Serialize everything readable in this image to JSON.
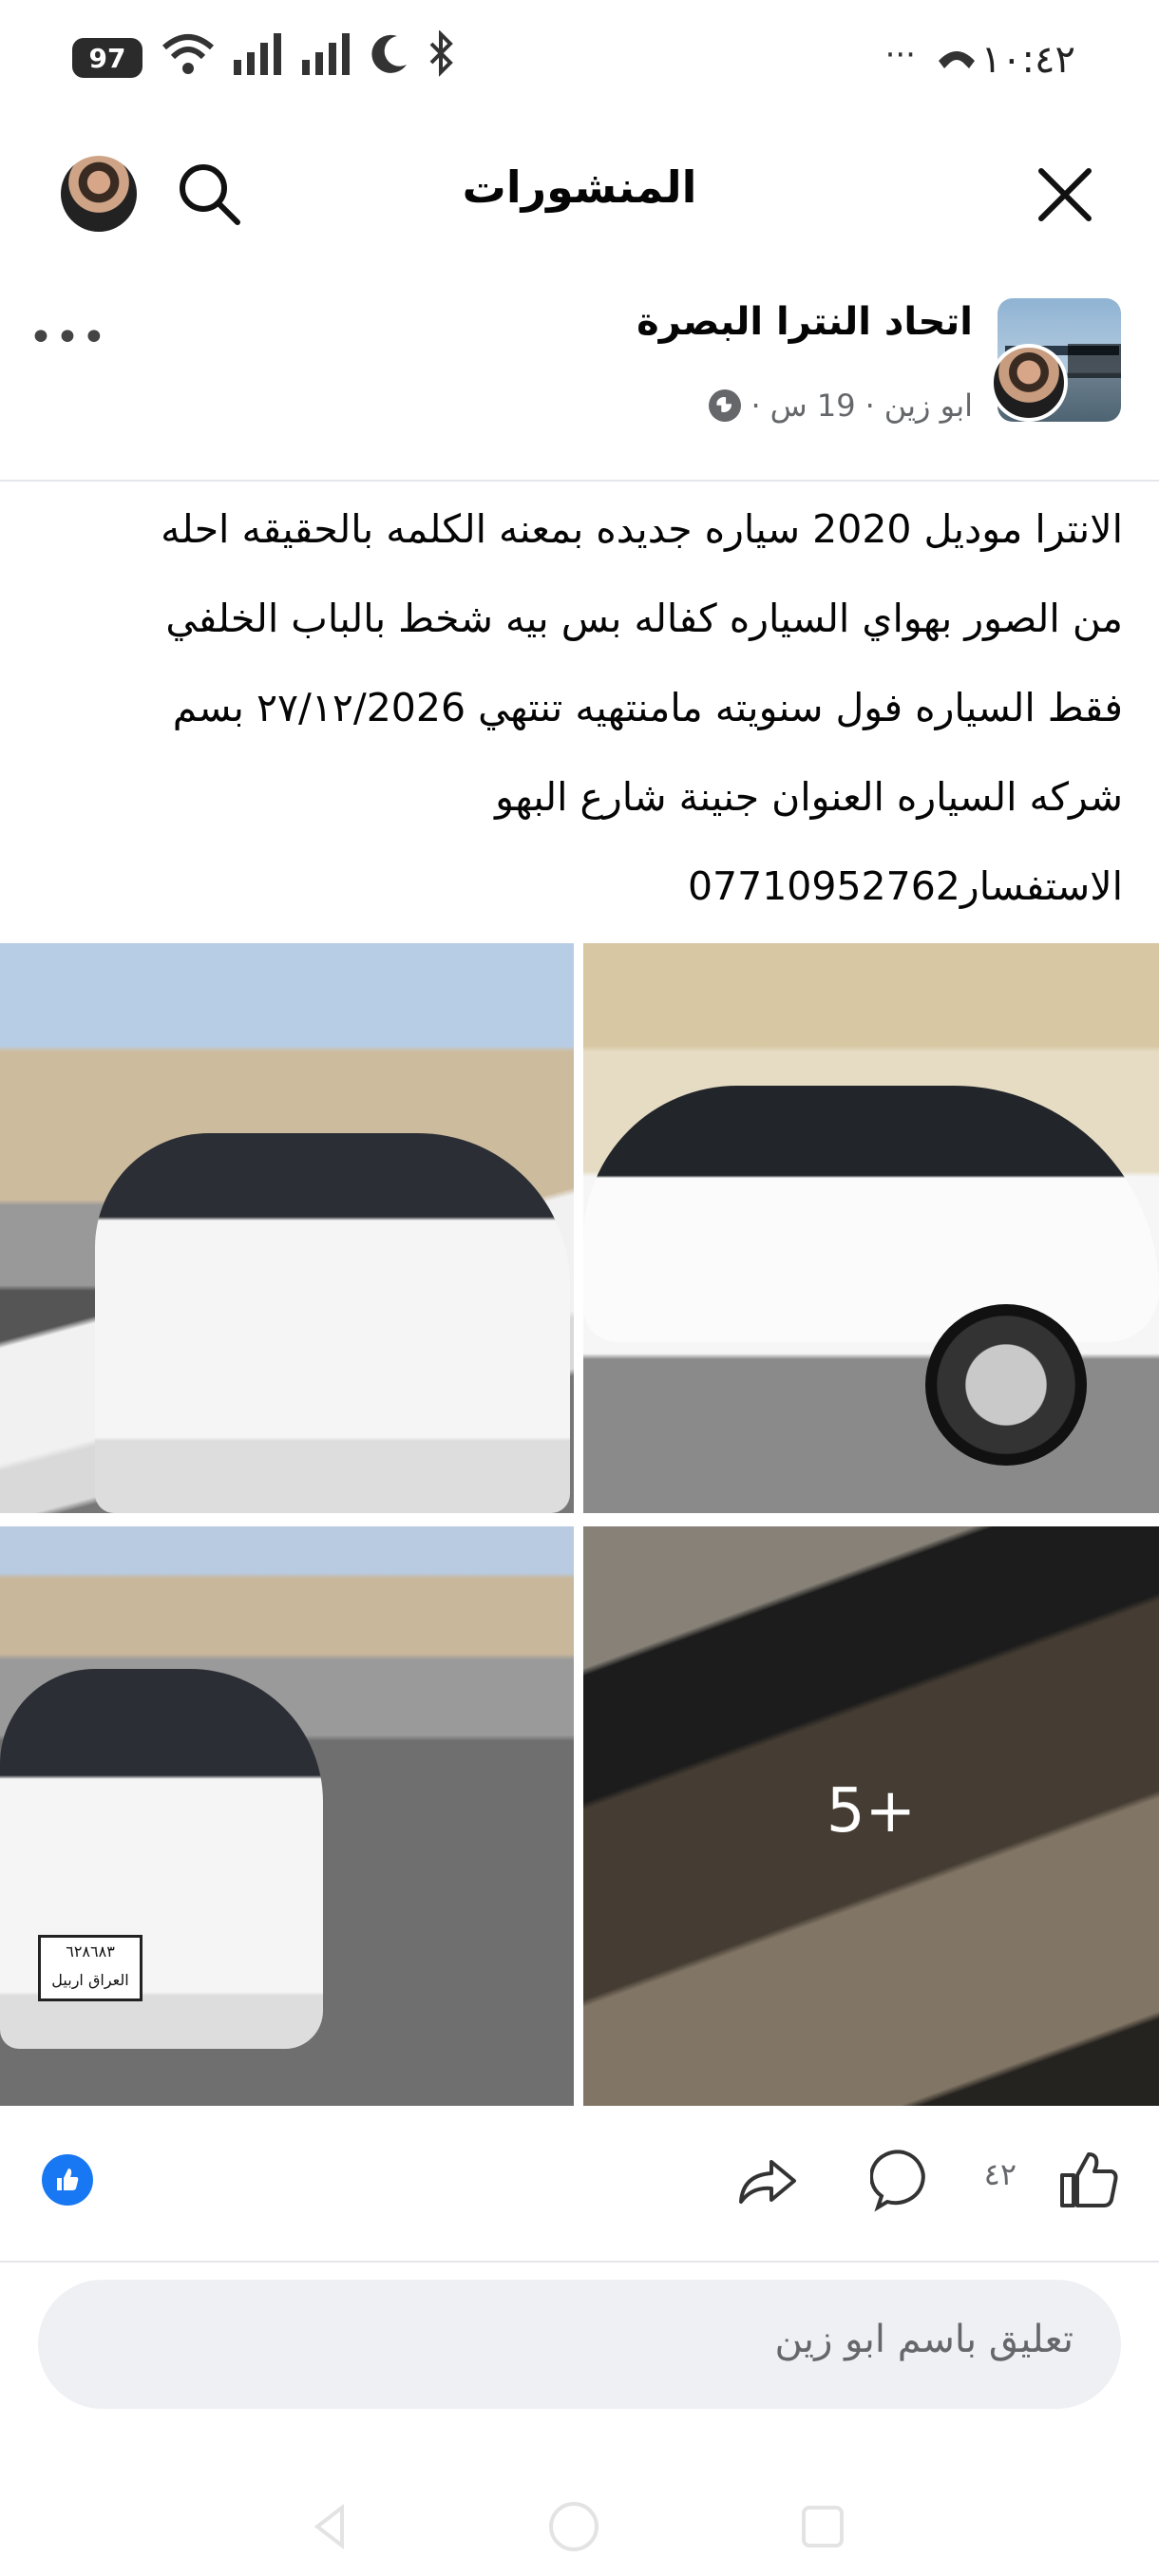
{
  "status_bar": {
    "battery": "97",
    "time": "١٠:٤٢",
    "more": "···"
  },
  "header": {
    "title": "المنشورات"
  },
  "post": {
    "group_name": "اتحاد النترا البصرة",
    "author": "ابو زين",
    "time_ago": "19 س",
    "separator": "·",
    "more_label": "•••",
    "text": "الانترا موديل 2020 سياره جديده بمعنه الكلمه بالحقيقه احله\nمن الصور بهواي السياره كفاله بس بيه شخط بالباب الخلفي\nفقط السياره فول سنويته مامنتهيه تنتهي ٢٧/١٢/2026 بسم\nشركه السياره العنوان جنينة شارع البهو\nالاستفسار07710952762",
    "more_photos": "5+",
    "plate_text": "٦٢٨٦٨٣\nالعراق اربيل",
    "like_count": "٤٢"
  },
  "comment": {
    "placeholder": "تعليق باسم ابو زين"
  },
  "colors": {
    "brand_blue": "#1877f2",
    "muted_text": "#65676b",
    "comment_bg": "#eff0f4"
  }
}
